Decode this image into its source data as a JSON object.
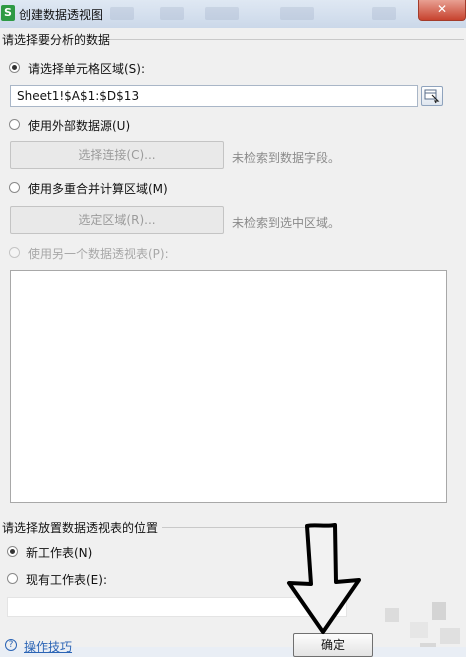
{
  "window": {
    "title": "创建数据透视图",
    "app_icon": "S",
    "close_symbol": "✕"
  },
  "source_section": {
    "title": "请选择要分析的数据",
    "option_cells": {
      "label": "请选择单元格区域(S):",
      "checked": true,
      "value": "Sheet1!$A$1:$D$13"
    },
    "option_external": {
      "label": "使用外部数据源(U)",
      "checked": false,
      "button_label": "选择连接(C)...",
      "hint": "未检索到数据字段。"
    },
    "option_multi": {
      "label": "使用多重合并计算区域(M)",
      "checked": false,
      "button_label": "选定区域(R)...",
      "hint": "未检索到选中区域。"
    },
    "option_pivot": {
      "label": "使用另一个数据透视表(P):",
      "checked": false,
      "disabled": true
    }
  },
  "location_section": {
    "title": "请选择放置数据透视表的位置",
    "option_new": {
      "label": "新工作表(N)",
      "checked": true
    },
    "option_existing": {
      "label": "现有工作表(E):",
      "checked": false
    }
  },
  "footer": {
    "help_label": "操作技巧",
    "ok_label": "确定"
  },
  "colors": {
    "accent_link": "#2b64b5",
    "close_button": "#c7432f",
    "dialog_bg": "#f0f0f0"
  }
}
